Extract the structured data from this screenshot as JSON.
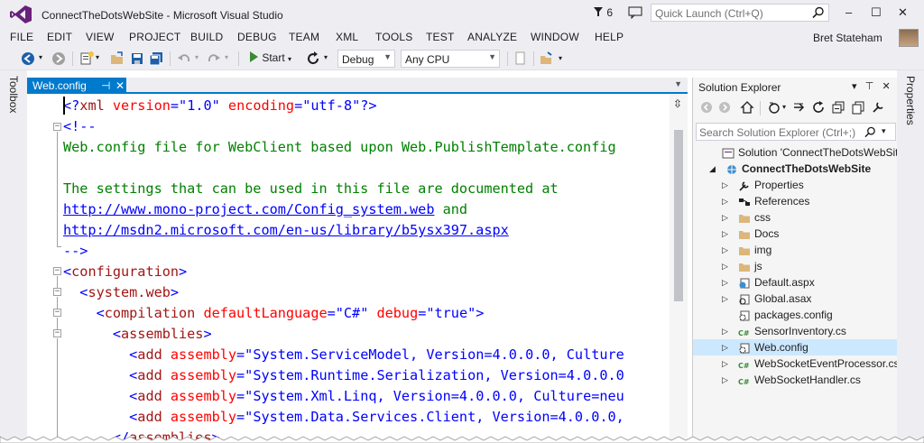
{
  "window": {
    "title": "ConnectTheDotsWebSite - Microsoft Visual Studio",
    "notification_count": "6",
    "quick_launch_placeholder": "Quick Launch (Ctrl+Q)",
    "minimize": "–",
    "maximize": "☐",
    "close": "✕"
  },
  "menu": [
    "FILE",
    "EDIT",
    "VIEW",
    "PROJECT",
    "BUILD",
    "DEBUG",
    "TEAM",
    "XML",
    "TOOLS",
    "TEST",
    "ANALYZE",
    "WINDOW",
    "HELP"
  ],
  "user": {
    "name": "Bret Stateham"
  },
  "toolbar": {
    "start_label": "Start",
    "configuration": "Debug",
    "platform": "Any CPU"
  },
  "side_panels": {
    "left": "Toolbox",
    "right": "Properties"
  },
  "editor": {
    "tab_label": "Web.config",
    "lines": [
      [
        [
          "c-blue",
          "<?"
        ],
        [
          "c-red",
          "xml "
        ],
        [
          "c-attr",
          "version"
        ],
        [
          "c-blue",
          "=\""
        ],
        [
          "c-blue",
          "1.0"
        ],
        [
          "c-blue",
          "\" "
        ],
        [
          "c-attr",
          "encoding"
        ],
        [
          "c-blue",
          "=\""
        ],
        [
          "c-blue",
          "utf-8"
        ],
        [
          "c-blue",
          "\"?>"
        ]
      ],
      [
        [
          "c-blue",
          "<!--"
        ]
      ],
      [
        [
          "c-green",
          "Web.config file for WebClient based upon Web.PublishTemplate.config"
        ]
      ],
      [
        [
          "c-green",
          ""
        ]
      ],
      [
        [
          "c-green",
          "The settings that can be used in this file are documented at"
        ]
      ],
      [
        [
          "c-link",
          "http://www.mono-project.com/Config_system.web"
        ],
        [
          "c-green",
          " and"
        ]
      ],
      [
        [
          "c-link",
          "http://msdn2.microsoft.com/en-us/library/b5ysx397.aspx"
        ]
      ],
      [
        [
          "c-blue",
          "-->"
        ]
      ],
      [
        [
          "c-blue",
          "<"
        ],
        [
          "c-red",
          "configuration"
        ],
        [
          "c-blue",
          ">"
        ]
      ],
      [
        [
          "c-blue",
          "  <"
        ],
        [
          "c-red",
          "system.web"
        ],
        [
          "c-blue",
          ">"
        ]
      ],
      [
        [
          "c-blue",
          "    <"
        ],
        [
          "c-red",
          "compilation "
        ],
        [
          "c-attr",
          "defaultLanguage"
        ],
        [
          "c-blue",
          "=\""
        ],
        [
          "c-blue",
          "C#"
        ],
        [
          "c-blue",
          "\" "
        ],
        [
          "c-attr",
          "debug"
        ],
        [
          "c-blue",
          "=\""
        ],
        [
          "c-blue",
          "true"
        ],
        [
          "c-blue",
          "\">"
        ]
      ],
      [
        [
          "c-blue",
          "      <"
        ],
        [
          "c-red",
          "assemblies"
        ],
        [
          "c-blue",
          ">"
        ]
      ],
      [
        [
          "c-blue",
          "        <"
        ],
        [
          "c-red",
          "add "
        ],
        [
          "c-attr",
          "assembly"
        ],
        [
          "c-blue",
          "=\""
        ],
        [
          "c-blue",
          "System.ServiceModel, Version=4.0.0.0, Culture"
        ]
      ],
      [
        [
          "c-blue",
          "        <"
        ],
        [
          "c-red",
          "add "
        ],
        [
          "c-attr",
          "assembly"
        ],
        [
          "c-blue",
          "=\""
        ],
        [
          "c-blue",
          "System.Runtime.Serialization, Version=4.0.0.0"
        ]
      ],
      [
        [
          "c-blue",
          "        <"
        ],
        [
          "c-red",
          "add "
        ],
        [
          "c-attr",
          "assembly"
        ],
        [
          "c-blue",
          "=\""
        ],
        [
          "c-blue",
          "System.Xml.Linq, Version=4.0.0.0, Culture=neu"
        ]
      ],
      [
        [
          "c-blue",
          "        <"
        ],
        [
          "c-red",
          "add "
        ],
        [
          "c-attr",
          "assembly"
        ],
        [
          "c-blue",
          "=\""
        ],
        [
          "c-blue",
          "System.Data.Services.Client, Version=4.0.0.0,"
        ]
      ],
      [
        [
          "c-blue",
          "      </"
        ],
        [
          "c-red",
          "assemblies"
        ],
        [
          "c-blue",
          ">"
        ]
      ]
    ]
  },
  "solution_explorer": {
    "title": "Solution Explorer",
    "search_placeholder": "Search Solution Explorer (Ctrl+;)",
    "nodes": [
      {
        "label": "Solution 'ConnectTheDotsWebSite' (",
        "level": 0,
        "expander": "",
        "icon": "solution-icon",
        "bold": false,
        "selected": false
      },
      {
        "label": "ConnectTheDotsWebSite",
        "level": 1,
        "expander": "◢",
        "icon": "web-project-icon",
        "bold": true,
        "selected": false
      },
      {
        "label": "Properties",
        "level": 2,
        "expander": "▷",
        "icon": "wrench-icon",
        "bold": false,
        "selected": false
      },
      {
        "label": "References",
        "level": 2,
        "expander": "▷",
        "icon": "references-icon",
        "bold": false,
        "selected": false
      },
      {
        "label": "css",
        "level": 2,
        "expander": "▷",
        "icon": "folder-icon",
        "bold": false,
        "selected": false
      },
      {
        "label": "Docs",
        "level": 2,
        "expander": "▷",
        "icon": "folder-icon",
        "bold": false,
        "selected": false
      },
      {
        "label": "img",
        "level": 2,
        "expander": "▷",
        "icon": "folder-icon",
        "bold": false,
        "selected": false
      },
      {
        "label": "js",
        "level": 2,
        "expander": "▷",
        "icon": "folder-icon",
        "bold": false,
        "selected": false
      },
      {
        "label": "Default.aspx",
        "level": 2,
        "expander": "▷",
        "icon": "aspx-icon",
        "bold": false,
        "selected": false
      },
      {
        "label": "Global.asax",
        "level": 2,
        "expander": "▷",
        "icon": "asax-icon",
        "bold": false,
        "selected": false
      },
      {
        "label": "packages.config",
        "level": 2,
        "expander": "",
        "icon": "config-icon",
        "bold": false,
        "selected": false
      },
      {
        "label": "SensorInventory.cs",
        "level": 2,
        "expander": "▷",
        "icon": "csharp-icon",
        "bold": false,
        "selected": false
      },
      {
        "label": "Web.config",
        "level": 2,
        "expander": "▷",
        "icon": "config-icon",
        "bold": false,
        "selected": true
      },
      {
        "label": "WebSocketEventProcessor.cs",
        "level": 2,
        "expander": "▷",
        "icon": "csharp-icon",
        "bold": false,
        "selected": false
      },
      {
        "label": "WebSocketHandler.cs",
        "level": 2,
        "expander": "▷",
        "icon": "csharp-icon",
        "bold": false,
        "selected": false
      }
    ]
  },
  "colors": {
    "accent": "#007acc",
    "vs_purple": "#68217a",
    "chrome": "#eeeef2",
    "xml_tag": "#a31515",
    "xml_attr": "#ff0000",
    "xml_punct": "#0000ff",
    "comment": "#008000"
  }
}
